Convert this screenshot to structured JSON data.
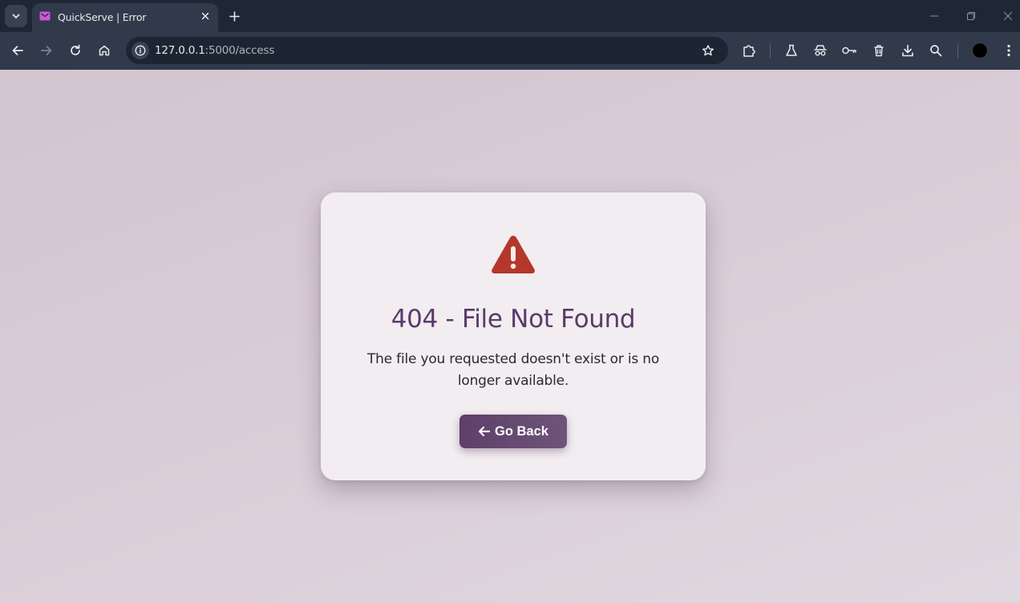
{
  "browser": {
    "tab": {
      "title": "QuickServe | Error"
    },
    "url": {
      "host": "127.0.0.1",
      "path": ":5000/access"
    }
  },
  "colors": {
    "page_bg": "#d6c9d3",
    "card_bg": "#f2edf1",
    "title": "#5a3a68",
    "warning_icon": "#b5372b",
    "button": "#5e3f6a"
  },
  "error": {
    "icon": "warning-triangle-icon",
    "title": "404 - File Not Found",
    "message": "The file you requested doesn't exist or is no longer available.",
    "button_label": "Go Back",
    "button_icon": "arrow-left-icon"
  }
}
